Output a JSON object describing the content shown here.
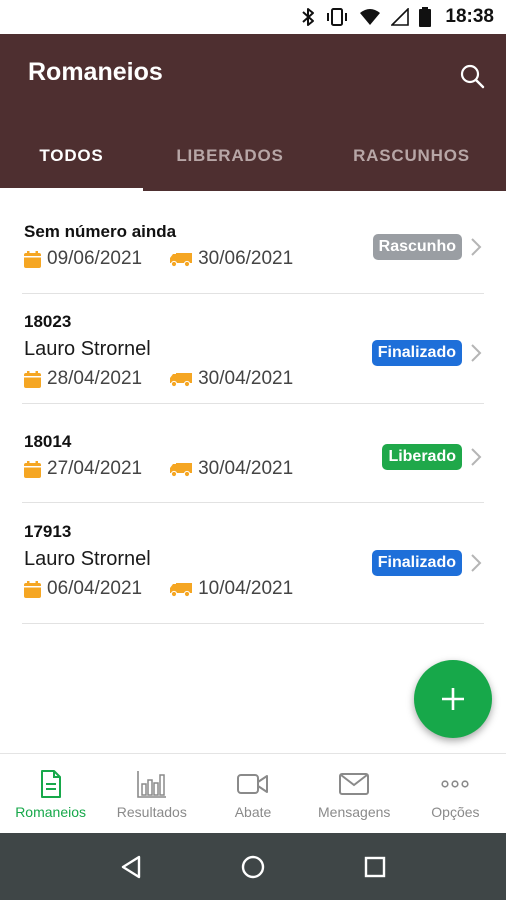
{
  "status_bar": {
    "time": "18:38"
  },
  "app_bar": {
    "title": "Romaneios"
  },
  "tabs": [
    {
      "label": "TODOS",
      "active": true
    },
    {
      "label": "LIBERADOS",
      "active": false
    },
    {
      "label": "RASCUNHOS",
      "active": false
    }
  ],
  "items": [
    {
      "number": "Sem número ainda",
      "name": "",
      "date_created": "09/06/2021",
      "date_shipping": "30/06/2021",
      "status": "Rascunho",
      "status_color": "#9a9ea3"
    },
    {
      "number": "18023",
      "name": "Lauro Strornel",
      "date_created": "28/04/2021",
      "date_shipping": "30/04/2021",
      "status": "Finalizado",
      "status_color": "#1e6fd9"
    },
    {
      "number": "18014",
      "name": "",
      "date_created": "27/04/2021",
      "date_shipping": "30/04/2021",
      "status": "Liberado",
      "status_color": "#1fa84a"
    },
    {
      "number": "17913",
      "name": "Lauro Strornel",
      "date_created": "06/04/2021",
      "date_shipping": "10/04/2021",
      "status": "Finalizado",
      "status_color": "#1e6fd9"
    }
  ],
  "bottom_nav": [
    {
      "label": "Romaneios",
      "icon": "document-icon",
      "active": true
    },
    {
      "label": "Resultados",
      "icon": "bar-chart-icon",
      "active": false
    },
    {
      "label": "Abate",
      "icon": "video-camera-icon",
      "active": false
    },
    {
      "label": "Mensagens",
      "icon": "envelope-icon",
      "active": false
    },
    {
      "label": "Opções",
      "icon": "more-horizontal-icon",
      "active": false
    }
  ],
  "colors": {
    "app_bar": "#4e2f30",
    "accent": "#17a84a",
    "date_icon": "#f5a623",
    "system_nav": "#3f4647"
  }
}
